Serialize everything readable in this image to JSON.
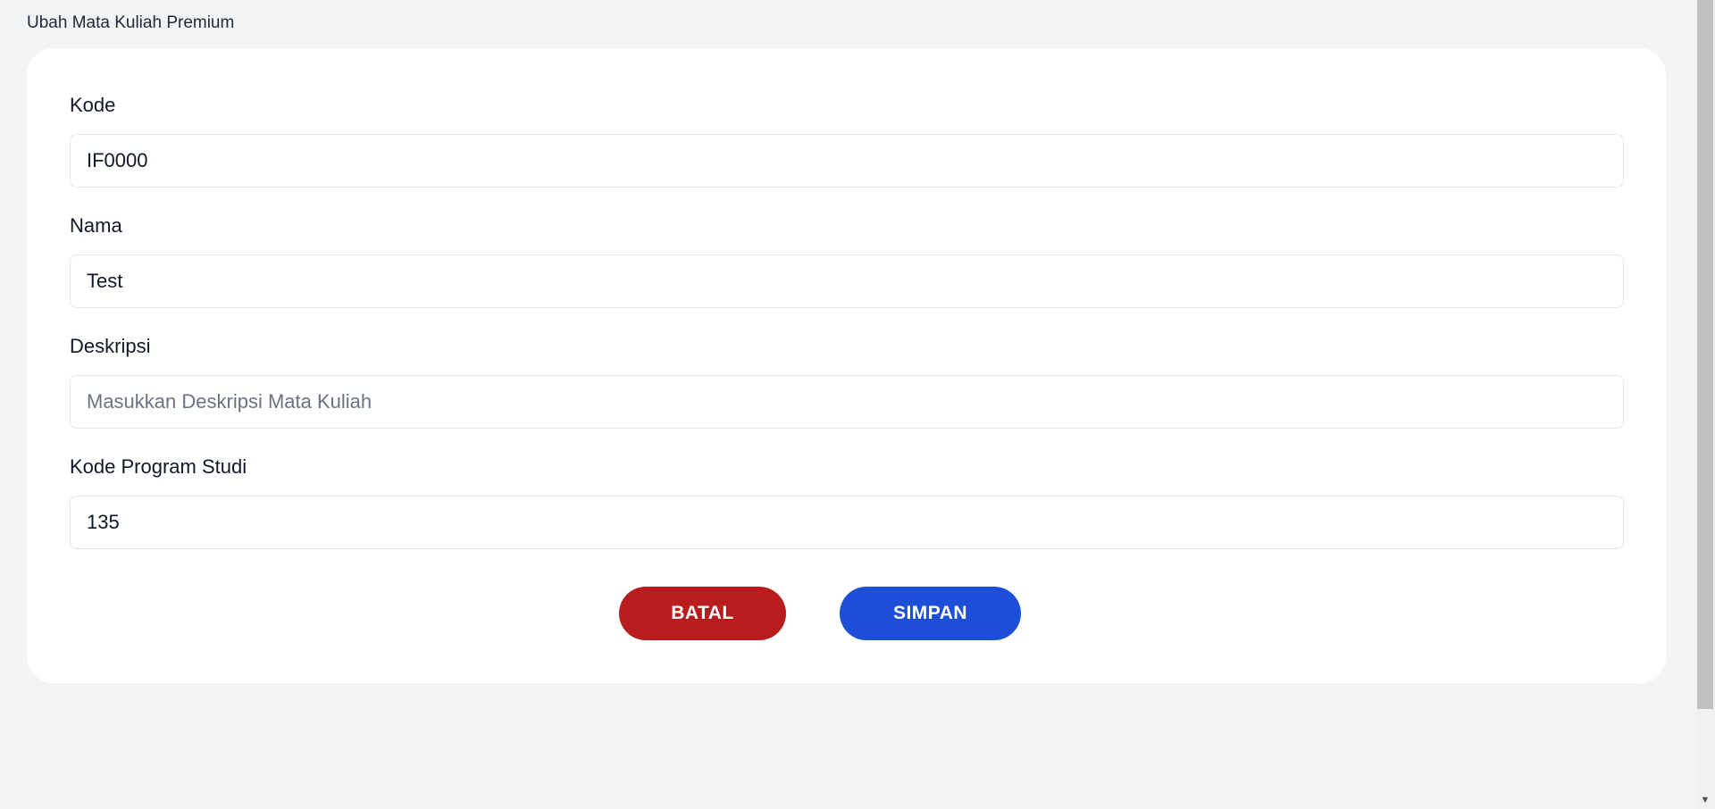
{
  "breadcrumb": "Ubah Mata Kuliah Premium",
  "form": {
    "kode": {
      "label": "Kode",
      "value": "IF0000",
      "placeholder": ""
    },
    "nama": {
      "label": "Nama",
      "value": "Test",
      "placeholder": ""
    },
    "deskripsi": {
      "label": "Deskripsi",
      "value": "",
      "placeholder": "Masukkan Deskripsi Mata Kuliah"
    },
    "kode_prodi": {
      "label": "Kode Program Studi",
      "value": "135",
      "placeholder": ""
    }
  },
  "buttons": {
    "cancel": "BATAL",
    "save": "SIMPAN"
  },
  "colors": {
    "background": "#f3f4f6",
    "card": "#ffffff",
    "cancel": "#b91c1c",
    "save": "#1d4ed8"
  },
  "icons": {
    "scroll_down": "scroll-down-arrow-icon"
  }
}
